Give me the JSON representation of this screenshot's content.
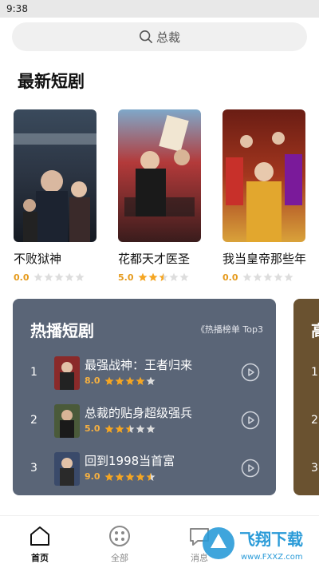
{
  "status": {
    "time": "9:38"
  },
  "search": {
    "placeholder": "总裁"
  },
  "section": {
    "title": "最新短剧"
  },
  "dramas": [
    {
      "title": "不败狱神",
      "rating": "0.0",
      "stars": 0,
      "poster_text": "不败狱神"
    },
    {
      "title": "花都天才医圣",
      "rating": "5.0",
      "stars": 2.5,
      "poster_text": "花都天才医圣"
    },
    {
      "title": "我当皇帝那些年",
      "rating": "0.0",
      "stars": 0,
      "poster_text": "我当皇帝那些年"
    }
  ],
  "hot": {
    "title": "热播短剧",
    "tag": "《热播榜单 Top3",
    "items": [
      {
        "rank": "1",
        "name": "最强战神：王者归来",
        "rating": "8.0",
        "stars": 4
      },
      {
        "rank": "2",
        "name": "总裁的贴身超级强兵",
        "rating": "5.0",
        "stars": 2.5
      },
      {
        "rank": "3",
        "name": "回到1998当首富",
        "rating": "9.0",
        "stars": 4.5
      }
    ]
  },
  "side_panel": {
    "title": "高",
    "ranks": [
      "1",
      "2",
      "3"
    ]
  },
  "tabs": [
    {
      "label": "首页",
      "icon": "home-icon",
      "active": true
    },
    {
      "label": "全部",
      "icon": "grid-circle-icon",
      "active": false
    },
    {
      "label": "消息",
      "icon": "message-icon",
      "active": false
    }
  ],
  "watermark": {
    "text": "飞翔下载",
    "url": "www.FXXZ.com"
  },
  "colors": {
    "star": "#f5a623",
    "star_empty": "#dddddd",
    "hot_panel": "#5a6577",
    "side_panel": "#6a5230"
  }
}
